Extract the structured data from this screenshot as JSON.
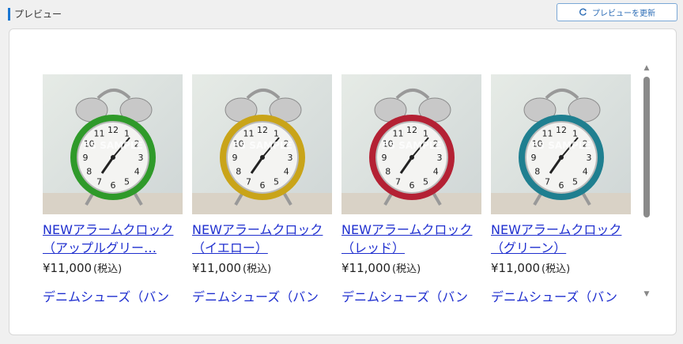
{
  "header": {
    "title": "プレビュー"
  },
  "toolbar": {
    "refresh_label": "プレビューを更新"
  },
  "products": [
    {
      "name_line1": "NEWアラームクロック",
      "name_line2": "（アップルグリー…",
      "price": "¥11,000",
      "tax": "(税込)",
      "next_name": "デニムシューズ（バン",
      "color": "#2f9a2a",
      "watermark": "FS SAMPLE"
    },
    {
      "name_line1": "NEWアラームクロック",
      "name_line2": "（イエロー）",
      "price": "¥11,000",
      "tax": "(税込)",
      "next_name": "デニムシューズ（バン",
      "color": "#c9a419",
      "watermark": "FS SAMPLE"
    },
    {
      "name_line1": "NEWアラームクロック",
      "name_line2": "（レッド）",
      "price": "¥11,000",
      "tax": "(税込)",
      "next_name": "デニムシューズ（バン",
      "color": "#b42134",
      "watermark": "FS SAMPLE"
    },
    {
      "name_line1": "NEWアラームクロック",
      "name_line2": "（グリーン）",
      "price": "¥11,000",
      "tax": "(税込)",
      "next_name": "デニムシューズ（バン",
      "color": "#1f7f90",
      "watermark": "FS SAMPLE"
    }
  ],
  "colors": {
    "accent": "#1976d2",
    "link": "#1f2fcf"
  }
}
